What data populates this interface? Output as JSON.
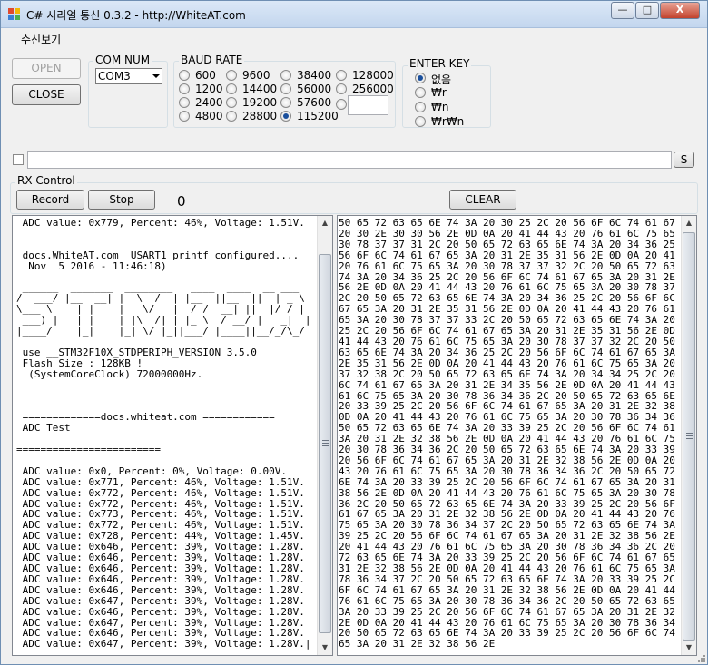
{
  "window": {
    "title": "C# 시리얼 통신 0.3.2 - http://WhiteAT.com",
    "minimize_glyph": "—",
    "maximize_glyph": "□",
    "close_glyph": "X"
  },
  "menu": {
    "items": [
      "수신보기"
    ]
  },
  "buttons": {
    "open": "OPEN",
    "close": "CLOSE",
    "send": "S"
  },
  "com_num": {
    "label": "COM NUM",
    "value": "COM3"
  },
  "baud_rate": {
    "label": "BAUD RATE",
    "options": [
      "600",
      "1200",
      "2400",
      "4800",
      "9600",
      "14400",
      "19200",
      "28800",
      "38400",
      "56000",
      "57600",
      "115200",
      "128000",
      "256000",
      ""
    ],
    "selected": "115200"
  },
  "enter_key": {
    "label": "ENTER KEY",
    "options": [
      "없음",
      "₩r",
      "₩n",
      "₩r₩n"
    ],
    "selected": "없음"
  },
  "rx_control": {
    "label": "RX Control",
    "record": "Record",
    "stop": "Stop",
    "count": "0",
    "clear": "CLEAR"
  },
  "terminal_lines": [
    " ADC value: 0x779, Percent: 46%, Voltage: 1.51V.",
    "",
    "",
    " docs.WhiteAT.com  USART1 printf configured....",
    "  Nov  5 2016 - 11:46:18)",
    "",
    " ______  _______  ________   ____  ____  __ ___  ",
    "/  ___/ |__  __| |  \\  /  | |__  ||__  ||  | _ \\ ",
    "\\___ \\    | |    |   \\/   |  / /  __| ||  |/ / |",
    " ___) |   | |    | |\\  /| | |_ \\  / __/ |   _|  |",
    "|____/    |_|    |_| \\/ |_||___/ |____||__/_/\\_/",
    "",
    " use __STM32F10X_STDPERIPH_VERSION 3.5.0",
    " Flash Size : 128KB !",
    "  (SystemCoreClock) 72000000Hz.",
    "",
    "",
    "",
    " =============docs.whiteat.com ============",
    " ADC Test",
    "",
    "========================",
    "",
    " ADC value: 0x0, Percent: 0%, Voltage: 0.00V.",
    " ADC value: 0x771, Percent: 46%, Voltage: 1.51V.",
    " ADC value: 0x772, Percent: 46%, Voltage: 1.51V.",
    " ADC value: 0x772, Percent: 46%, Voltage: 1.51V.",
    " ADC value: 0x773, Percent: 46%, Voltage: 1.51V.",
    " ADC value: 0x772, Percent: 46%, Voltage: 1.51V.",
    " ADC value: 0x728, Percent: 44%, Voltage: 1.45V.",
    " ADC value: 0x646, Percent: 39%, Voltage: 1.28V.",
    " ADC value: 0x646, Percent: 39%, Voltage: 1.28V.",
    " ADC value: 0x646, Percent: 39%, Voltage: 1.28V.",
    " ADC value: 0x646, Percent: 39%, Voltage: 1.28V.",
    " ADC value: 0x646, Percent: 39%, Voltage: 1.28V.",
    " ADC value: 0x647, Percent: 39%, Voltage: 1.28V.",
    " ADC value: 0x646, Percent: 39%, Voltage: 1.28V.",
    " ADC value: 0x647, Percent: 39%, Voltage: 1.28V.",
    " ADC value: 0x646, Percent: 39%, Voltage: 1.28V.",
    " ADC value: 0x647, Percent: 39%, Voltage: 1.28V.|"
  ],
  "hex_lines": [
    "50 65 72 63 65 6E 74 3A 20 30 25 2C 20 56 6F 6C 74 61 67 65 3A",
    "20 30 2E 30 30 56 2E 0D 0A 20 41 44 43 20 76 61 6C 75 65 3A 20",
    "30 78 37 37 31 2C 20 50 65 72 63 65 6E 74 3A 20 34 36 25 2C 20",
    "56 6F 6C 74 61 67 65 3A 20 31 2E 35 31 56 2E 0D 0A 20 41 44 43",
    "20 76 61 6C 75 65 3A 20 30 78 37 37 32 2C 20 50 65 72 63 65 6E",
    "74 3A 20 34 36 25 2C 20 56 6F 6C 74 61 67 65 3A 20 31 2E 35 31",
    "56 2E 0D 0A 20 41 44 43 20 76 61 6C 75 65 3A 20 30 78 37 37 32",
    "2C 20 50 65 72 63 65 6E 74 3A 20 34 36 25 2C 20 56 6F 6C 74 61",
    "67 65 3A 20 31 2E 35 31 56 2E 0D 0A 20 41 44 43 20 76 61 6C 75",
    "65 3A 20 30 78 37 37 33 2C 20 50 65 72 63 65 6E 74 3A 20 34 36",
    "25 2C 20 56 6F 6C 74 61 67 65 3A 20 31 2E 35 31 56 2E 0D 0A 20",
    "41 44 43 20 76 61 6C 75 65 3A 20 30 78 37 37 32 2C 20 50 65 72",
    "63 65 6E 74 3A 20 34 36 25 2C 20 56 6F 6C 74 61 67 65 3A 20 31",
    "2E 35 31 56 2E 0D 0A 20 41 44 43 20 76 61 6C 75 65 3A 20 30 78",
    "37 32 38 2C 20 50 65 72 63 65 6E 74 3A 20 34 34 25 2C 20 56 6F",
    "6C 74 61 67 65 3A 20 31 2E 34 35 56 2E 0D 0A 20 41 44 43 20 76",
    "61 6C 75 65 3A 20 30 78 36 34 36 2C 20 50 65 72 63 65 6E 74 3A",
    "20 33 39 25 2C 20 56 6F 6C 74 61 67 65 3A 20 31 2E 32 38 56 2E",
    "0D 0A 20 41 44 43 20 76 61 6C 75 65 3A 20 30 78 36 34 36 2C 20",
    "50 65 72 63 65 6E 74 3A 20 33 39 25 2C 20 56 6F 6C 74 61 67 65",
    "3A 20 31 2E 32 38 56 2E 0D 0A 20 41 44 43 20 76 61 6C 75 65 3A",
    "20 30 78 36 34 36 2C 20 50 65 72 63 65 6E 74 3A 20 33 39 25 2C",
    "20 56 6F 6C 74 61 67 65 3A 20 31 2E 32 38 56 2E 0D 0A 20 41 44",
    "43 20 76 61 6C 75 65 3A 20 30 78 36 34 36 2C 20 50 65 72 63 65",
    "6E 74 3A 20 33 39 25 2C 20 56 6F 6C 74 61 67 65 3A 20 31 2E 32",
    "38 56 2E 0D 0A 20 41 44 43 20 76 61 6C 75 65 3A 20 30 78 36 34",
    "36 2C 20 50 65 72 63 65 6E 74 3A 20 33 39 25 2C 20 56 6F 6C 74",
    "61 67 65 3A 20 31 2E 32 38 56 2E 0D 0A 20 41 44 43 20 76 61 6C",
    "75 65 3A 20 30 78 36 34 37 2C 20 50 65 72 63 65 6E 74 3A 20 33",
    "39 25 2C 20 56 6F 6C 74 61 67 65 3A 20 31 2E 32 38 56 2E 0D 0A",
    "20 41 44 43 20 76 61 6C 75 65 3A 20 30 78 36 34 36 2C 20 50 65",
    "72 63 65 6E 74 3A 20 33 39 25 2C 20 56 6F 6C 74 61 67 65 3A 20",
    "31 2E 32 38 56 2E 0D 0A 20 41 44 43 20 76 61 6C 75 65 3A 20 30",
    "78 36 34 37 2C 20 50 65 72 63 65 6E 74 3A 20 33 39 25 2C 20 56",
    "6F 6C 74 61 67 65 3A 20 31 2E 32 38 56 2E 0D 0A 20 41 44 43 20",
    "76 61 6C 75 65 3A 20 30 78 36 34 36 2C 20 50 65 72 63 65 6E 74",
    "3A 20 33 39 25 2C 20 56 6F 6C 74 61 67 65 3A 20 31 2E 32 38 56",
    "2E 0D 0A 20 41 44 43 20 76 61 6C 75 65 3A 20 30 78 36 34 37 2C",
    "20 50 65 72 63 65 6E 74 3A 20 33 39 25 2C 20 56 6F 6C 74 61 67",
    "65 3A 20 31 2E 32 38 56 2E"
  ]
}
